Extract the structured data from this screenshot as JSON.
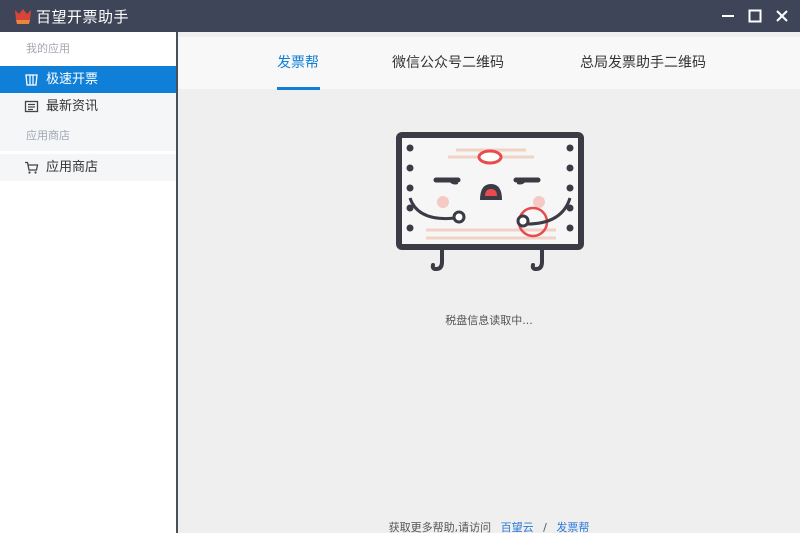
{
  "window": {
    "title": "百望开票助手",
    "brand_color": "#3f4558",
    "accent_color": "#0f7fd8",
    "controls": [
      "minimize-icon",
      "maximize-icon",
      "close-icon"
    ]
  },
  "sidebar": {
    "section1_title": "我的应用",
    "items": [
      {
        "label": "极速开票",
        "icon": "invoice-icon",
        "active": true
      },
      {
        "label": "最新资讯",
        "icon": "news-icon",
        "active": false
      }
    ],
    "section2_title": "应用商店",
    "store_items": [
      {
        "label": "应用商店",
        "icon": "cart-icon"
      }
    ]
  },
  "tabs": [
    {
      "label": "发票帮",
      "active": true
    },
    {
      "label": "微信公众号二维码",
      "active": false
    },
    {
      "label": "总局发票助手二维码",
      "active": false
    }
  ],
  "main": {
    "status": "税盘信息读取中..."
  },
  "footer": {
    "prefix": "获取更多帮助,请访问",
    "link1": "百望云",
    "separator": "/",
    "link2": "发票帮"
  }
}
